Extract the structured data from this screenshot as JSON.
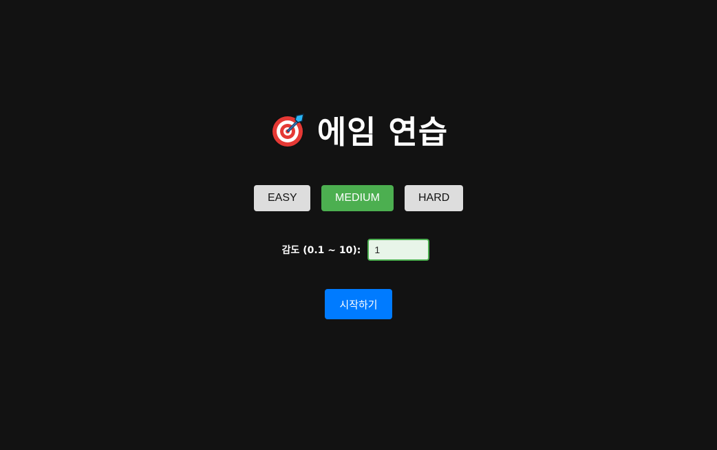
{
  "header": {
    "title": "에임 연습",
    "icon": "target-dart-icon"
  },
  "difficulty": {
    "options": [
      {
        "label": "EASY",
        "active": false
      },
      {
        "label": "MEDIUM",
        "active": true
      },
      {
        "label": "HARD",
        "active": false
      }
    ],
    "active_color": "#4caf50",
    "inactive_color": "#dddddd"
  },
  "sensitivity": {
    "label": "감도 (0.1 ~ 10):",
    "value": "1"
  },
  "start": {
    "label": "시작하기",
    "color": "#007bff"
  },
  "background_color": "#121212"
}
